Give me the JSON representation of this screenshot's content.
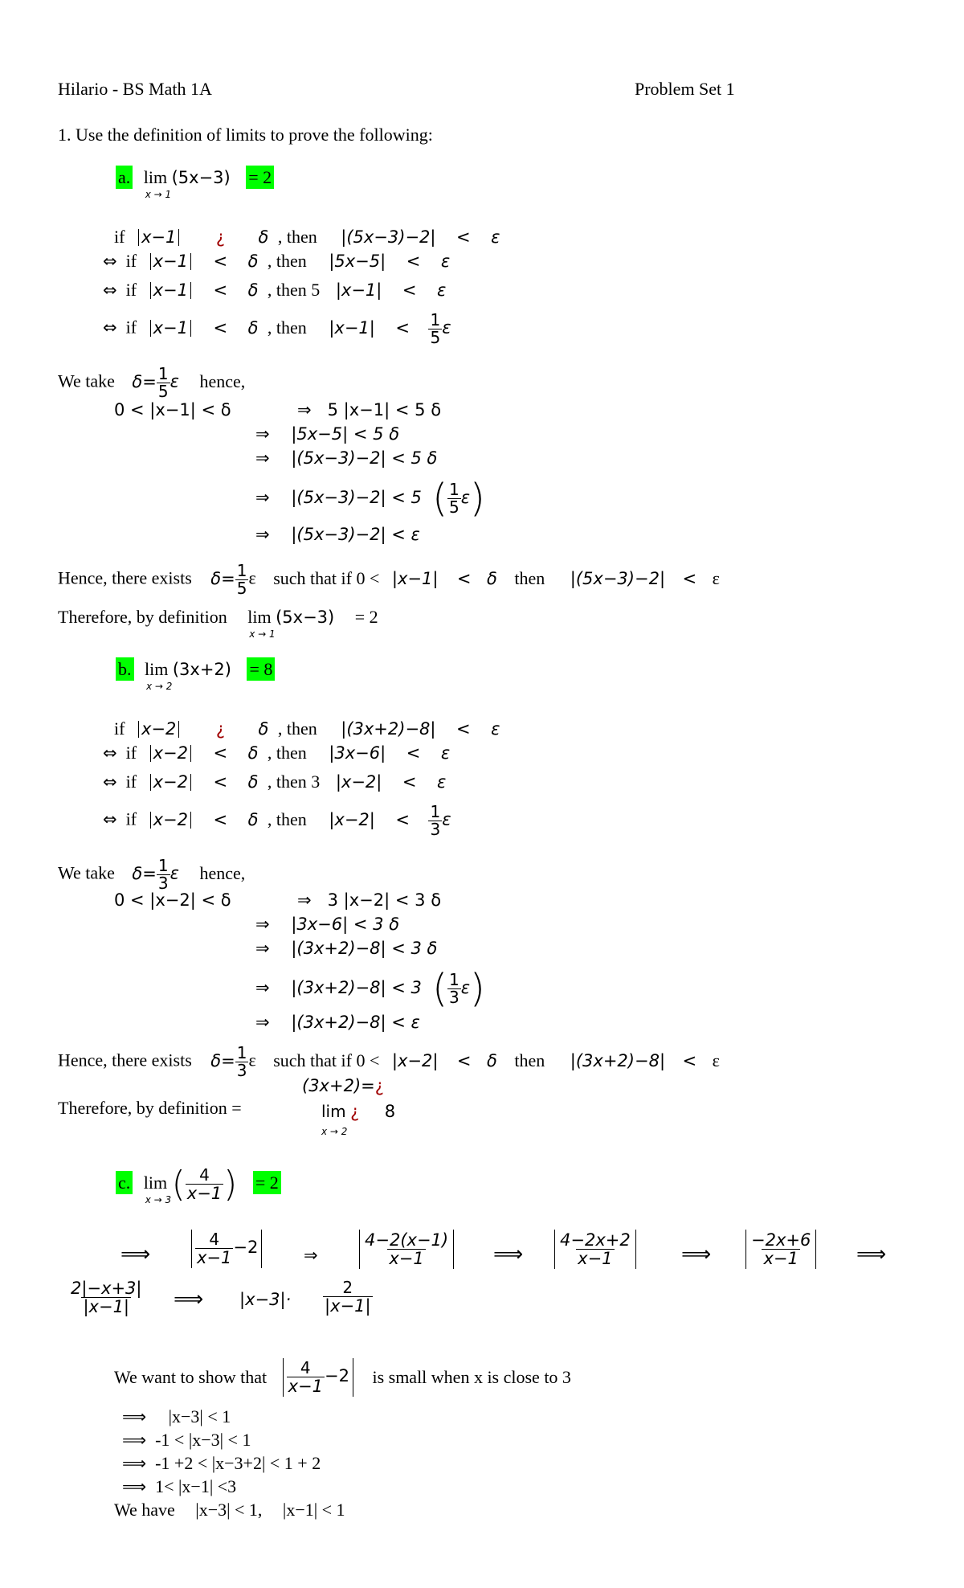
{
  "header": {
    "left": "Hilario - BS Math 1A",
    "right": "Problem Set 1"
  },
  "question": "1. Use the definition of limits to prove the following:",
  "colors": {
    "highlight": "#00ff00",
    "error_glyph": "#a00000"
  },
  "part_a": {
    "label": "a.",
    "lim": "lim",
    "lim_sub": "x → 1",
    "expr": "(5x−3)",
    "result": "= 2",
    "steps": [
      {
        "prefix": "if",
        "abs_left": "x−1",
        "op": "¿",
        "delta": "δ",
        "then": ", then",
        "right": "|(5x−3)−2|",
        "rel": "<",
        "eps": "ε"
      },
      {
        "iff": "⇔",
        "prefix": "if",
        "abs_left": "x−1",
        "op": "<",
        "delta": "δ",
        "then": ", then",
        "right": "|5x−5|",
        "rel": "<",
        "eps": "ε"
      },
      {
        "iff": "⇔",
        "prefix": "if",
        "abs_left": "x−1",
        "op": "<",
        "delta": "δ",
        "then": ", then 5",
        "right": "|x−1|",
        "rel": "<",
        "eps": "ε"
      },
      {
        "iff": "⇔",
        "prefix": "if",
        "abs_left": "x−1",
        "op": "<",
        "delta": "δ",
        "then": ", then",
        "right": "|x−1|",
        "rel": "<",
        "frac_num": "1",
        "frac_den": "5",
        "eps": "ε"
      }
    ],
    "we_take": "We take",
    "delta_eq": "δ=",
    "frac_num": "1",
    "frac_den": "5",
    "eps": "ε",
    "hence": "hence,",
    "chain_start": "0 <  |x−1|  <  δ",
    "chain": [
      {
        "arrow": "⇒",
        "text": "5  |x−1|   < 5  δ"
      },
      {
        "arrow": "⇒",
        "text": "|5x−5|   < 5  δ"
      },
      {
        "arrow": "⇒",
        "text": "|(5x−3)−2|   < 5  δ"
      },
      {
        "arrow": "⇒",
        "text": "|(5x−3)−2|   < 5",
        "paren_num": "1",
        "paren_den": "5",
        "paren_eps": "ε"
      },
      {
        "arrow": "⇒",
        "text": "|(5x−3)−2|   <   ε"
      }
    ],
    "conclusion_1": "Hence, there exists",
    "conclusion_1b": "such that if 0 <",
    "conclusion_abs": "|x−1|",
    "conclusion_lt": "<",
    "conclusion_delta": "δ",
    "conclusion_then": "then",
    "conclusion_right": "|(5x−3)−2|",
    "conclusion_eps": "ε",
    "therefore": "Therefore, by definition",
    "therefore_expr": "(5x−3)",
    "therefore_result": "= 2"
  },
  "part_b": {
    "label": "b.",
    "lim": "lim",
    "lim_sub": "x → 2",
    "expr": "(3x+2)",
    "result": "= 8",
    "steps": [
      {
        "prefix": "if",
        "abs_left": "x−2",
        "op": "¿",
        "delta": "δ",
        "then": ", then",
        "right": "|(3x+2)−8|",
        "rel": "<",
        "eps": "ε"
      },
      {
        "iff": "⇔",
        "prefix": "if",
        "abs_left": "x−2",
        "op": "<",
        "delta": "δ",
        "then": ", then",
        "right": "|3x−6|",
        "rel": "<",
        "eps": "ε"
      },
      {
        "iff": "⇔",
        "prefix": "if",
        "abs_left": "x−2",
        "op": "<",
        "delta": "δ",
        "then": ", then 3",
        "right": "|x−2|",
        "rel": "<",
        "eps": "ε"
      },
      {
        "iff": "⇔",
        "prefix": "if",
        "abs_left": "x−2",
        "op": "<",
        "delta": "δ",
        "then": ", then",
        "right": "|x−2|",
        "rel": "<",
        "frac_num": "1",
        "frac_den": "3",
        "eps": "ε"
      }
    ],
    "we_take": "We take",
    "delta_eq": "δ=",
    "frac_num": "1",
    "frac_den": "3",
    "eps": "ε",
    "hence": "hence,",
    "chain_start": "0 <  |x−2|  <  δ",
    "chain": [
      {
        "arrow": "⇒",
        "text": "3  |x−2|   < 3  δ"
      },
      {
        "arrow": "⇒",
        "text": "|3x−6|   < 3  δ"
      },
      {
        "arrow": "⇒",
        "text": "|(3x+2)−8|   < 3  δ"
      },
      {
        "arrow": "⇒",
        "text": "|(3x+2)−8|   < 3",
        "paren_num": "1",
        "paren_den": "3",
        "paren_eps": "ε"
      },
      {
        "arrow": "⇒",
        "text": "|(3x+2)−8|   <   ε"
      }
    ],
    "conclusion_1": "Hence, there exists",
    "conclusion_1b": "such that if 0 <",
    "conclusion_abs": "|x−2|",
    "conclusion_lt": "<",
    "conclusion_delta": "δ",
    "conclusion_then": "then",
    "conclusion_right": "|(3x+2)−8|",
    "conclusion_eps": "ε",
    "therefore": "Therefore, by definition  =",
    "therefore_top": "(3x+2)=",
    "therefore_glyph": "¿",
    "therefore_lim": "lim",
    "therefore_sub": "x → 2",
    "therefore_result": "8"
  },
  "part_c": {
    "label": "c.",
    "lim": "lim",
    "lim_sub": "x → 3",
    "frac_num": "4",
    "frac_den": "x−1",
    "result": "= 2",
    "row1": [
      {
        "arrow": "⟹"
      },
      {
        "num": "4",
        "den": "x−1",
        "tail": "−2"
      },
      {
        "arrow": "⇒"
      },
      {
        "num": "4−2(x−1)",
        "den": "x−1"
      },
      {
        "arrow": "⟹"
      },
      {
        "num": "4−2x+2",
        "den": "x−1"
      },
      {
        "arrow": "⟹"
      },
      {
        "num": "−2x+6",
        "den": "x−1"
      },
      {
        "arrow": "⟹"
      }
    ],
    "row2": {
      "num": "2|−x+3|",
      "den": "|x−1|",
      "arrow": "⟹",
      "mid": "|x−3|·",
      "num2": "2",
      "den2": "|x−1|"
    },
    "want": "We want to show that",
    "want_num": "4",
    "want_den": "x−1",
    "want_tail": "−2",
    "want_end": "is small when x is close to 3",
    "bounds": [
      {
        "arrow": "⟹",
        "text": "|x−3|   < 1"
      },
      {
        "arrow": "⟹",
        "text": "-1 <   |x−3|   < 1"
      },
      {
        "arrow": "⟹",
        "text": "-1 +2 <   |x−3+2|   < 1 + 2"
      },
      {
        "arrow": "⟹",
        "text": "1<   |x−1|   <3"
      }
    ],
    "we_have": "We have",
    "we_have_1": "|x−3|   < 1,",
    "we_have_2": "|x−1|  < 1"
  }
}
